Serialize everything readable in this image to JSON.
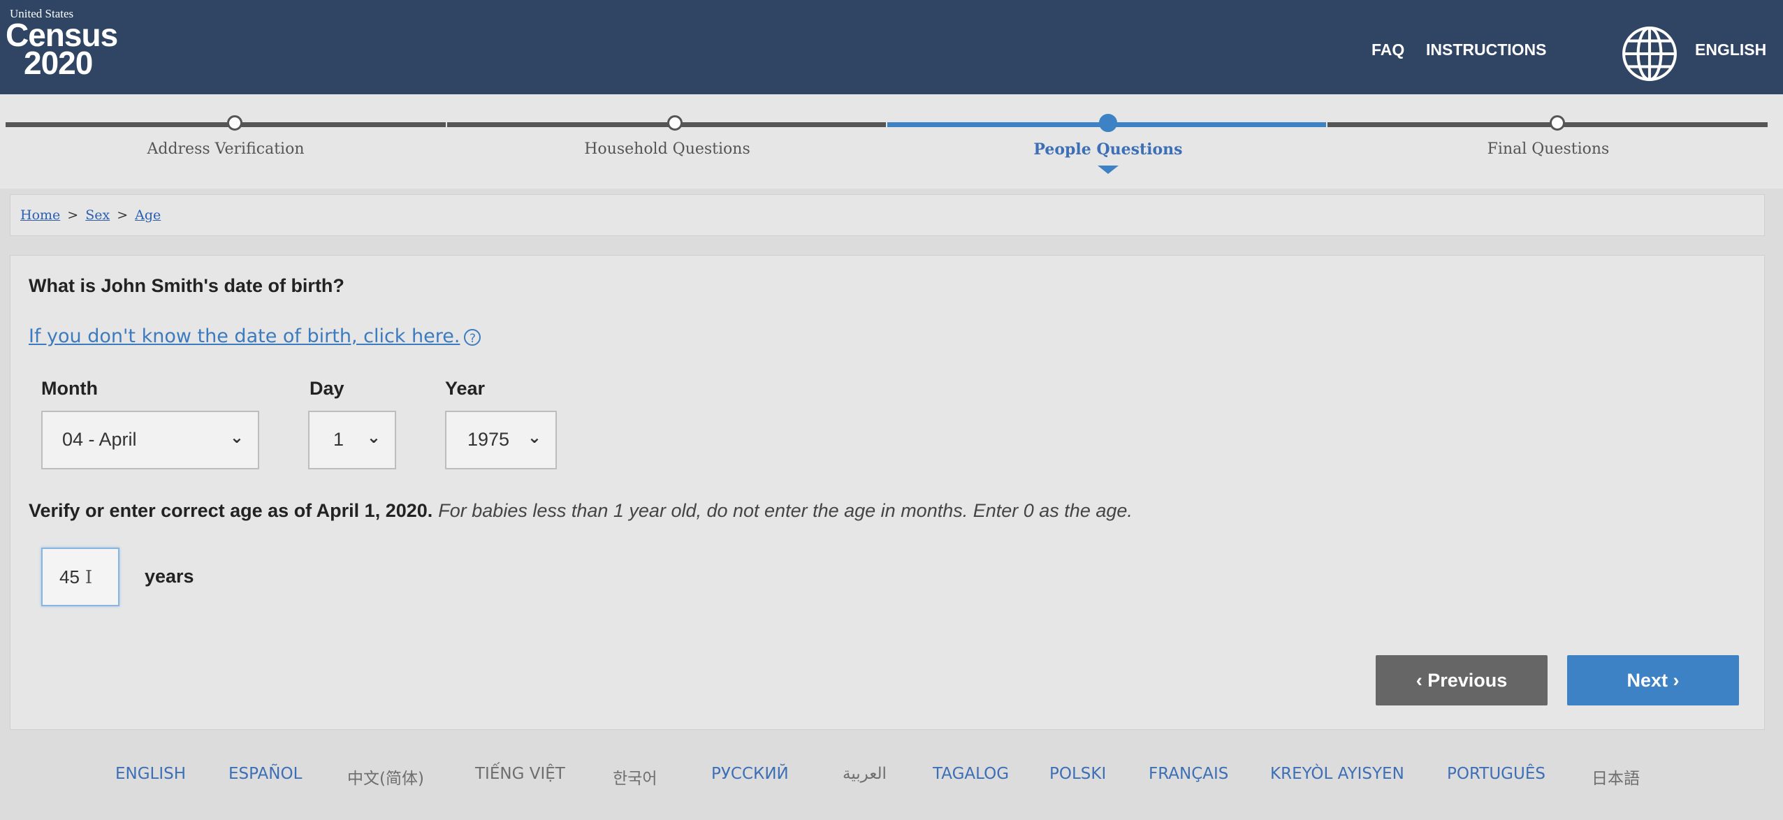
{
  "header": {
    "logo_line1": "United States",
    "logo_line2": "Census",
    "logo_line3": "2020",
    "faq": "FAQ",
    "instructions": "INSTRUCTIONS",
    "language": "ENGLISH",
    "bg_color": "#2f4563"
  },
  "progress": {
    "steps": [
      {
        "label": "Address Verification",
        "state": "done"
      },
      {
        "label": "Household Questions",
        "state": "done"
      },
      {
        "label": "People Questions",
        "state": "current"
      },
      {
        "label": "Final Questions",
        "state": "upcoming"
      }
    ],
    "accent_color": "#3d82c5"
  },
  "breadcrumb": {
    "items": [
      "Home",
      "Sex",
      "Age"
    ],
    "separator": ">"
  },
  "form": {
    "question": "What is John Smith's date of birth?",
    "help_link": "If you don't know the date of birth, click here.",
    "help_icon": "?",
    "month_label": "Month",
    "month_value": "04  -  April",
    "day_label": "Day",
    "day_value": "1",
    "year_label": "Year",
    "year_value": "1975",
    "age_prompt": "Verify or enter correct age as of April 1, 2020.",
    "age_note": "For babies less than 1 year old, do not enter the age in months. Enter 0 as the age.",
    "age_value": "45",
    "age_unit": "years",
    "previous_label": "Previous",
    "next_label": "Next"
  },
  "languages": [
    "ENGLISH",
    "ESPAÑOL",
    "中文(简体)",
    "TIẾNG VIỆT",
    "한국어",
    "РУССКИЙ",
    "العربية",
    "TAGALOG",
    "POLSKI",
    "FRANÇAIS",
    "KREYÒL AYISYEN",
    "PORTUGUÊS",
    "日本語"
  ]
}
